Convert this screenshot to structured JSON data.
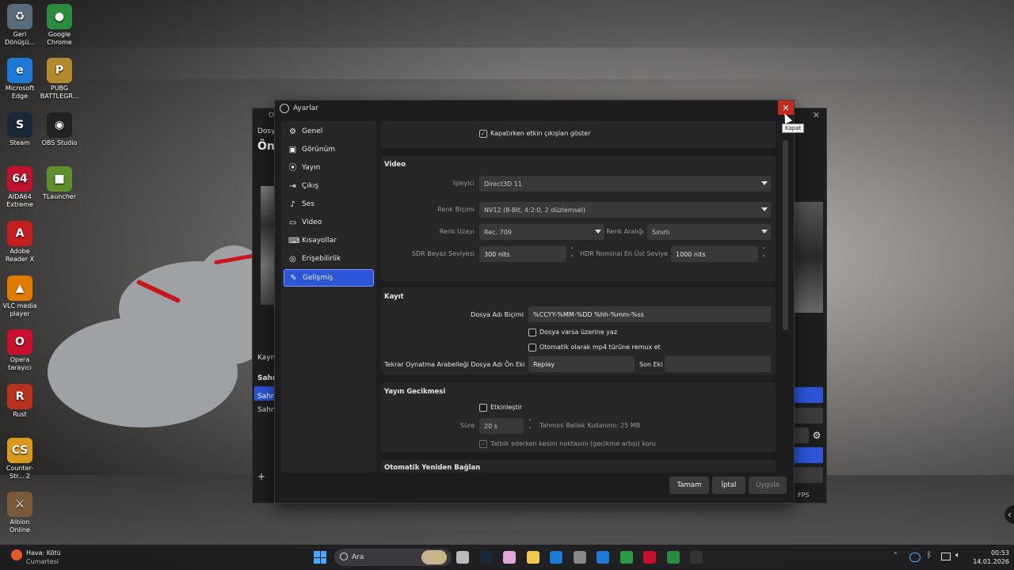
{
  "desktop": {
    "icons": [
      {
        "label": "Geri Dönüşü...",
        "glyph": "♻",
        "bg": "#5a6b7a"
      },
      {
        "label": "Google Chrome",
        "glyph": "●",
        "bg": "#2a8c3c"
      },
      {
        "label": "Microsoft Edge",
        "glyph": "e",
        "bg": "#1d7ad6"
      },
      {
        "label": "PUBG BATTLEGR...",
        "glyph": "P",
        "bg": "#b08a2c"
      },
      {
        "label": "Steam",
        "glyph": "S",
        "bg": "#1b2838"
      },
      {
        "label": "OBS Studio",
        "glyph": "◉",
        "bg": "#222"
      },
      {
        "label": "AIDA64 Extreme",
        "glyph": "64",
        "bg": "#c0122b"
      },
      {
        "label": "TLauncher",
        "glyph": "■",
        "bg": "#5f8f2c"
      },
      {
        "label": "Adobe Reader X",
        "glyph": "A",
        "bg": "#c41e1e"
      },
      {
        "label": "VLC media player",
        "glyph": "▲",
        "bg": "#e07b00"
      },
      {
        "label": "Opera tarayıcı",
        "glyph": "O",
        "bg": "#c8102e"
      },
      {
        "label": "Rust",
        "glyph": "R",
        "bg": "#b8321e"
      },
      {
        "label": "Counter-Str... 2",
        "glyph": "CS",
        "bg": "#d99a1c"
      },
      {
        "label": "Albion Online",
        "glyph": "⚔",
        "bg": "#7a5a3a"
      }
    ]
  },
  "obs_back": {
    "title_fragment": "Ol",
    "menu_fragment": "Dosya",
    "preview_fragment": "Öni",
    "sources_fragment": "Kayna",
    "scenes_header_fragment": "Sahne",
    "scene1_fragment": "Sahne",
    "scene2_fragment": "Sahne",
    "fps_text": "FPS"
  },
  "dialog": {
    "title": "Ayarlar",
    "close_glyph": "✕",
    "tooltip": "Kapat",
    "sidebar": [
      {
        "label": "Genel",
        "glyph": "⚙"
      },
      {
        "label": "Görünüm",
        "glyph": "▣"
      },
      {
        "label": "Yayın",
        "glyph": "⦿"
      },
      {
        "label": "Çıkış",
        "glyph": "⇥"
      },
      {
        "label": "Ses",
        "glyph": "♪"
      },
      {
        "label": "Video",
        "glyph": "▭"
      },
      {
        "label": "Kısayollar",
        "glyph": "⌨"
      },
      {
        "label": "Erişebilirlik",
        "glyph": "◎"
      },
      {
        "label": "Gelişmiş",
        "glyph": "✎"
      }
    ],
    "active_item": "Gelişmiş",
    "general": {
      "show_active_outputs_label": "Kapatırken etkin çıkışları göster"
    },
    "video": {
      "title": "Video",
      "renderer_label": "İşleyici",
      "renderer_value": "Direct3D 11",
      "color_format_label": "Renk Biçimi",
      "color_format_value": "NV12 (8-Bit, 4:2:0, 2 düzlemsel)",
      "color_space_label": "Renk Uzayı",
      "color_space_value": "Rec. 709",
      "color_range_label": "Renk Aralığı",
      "color_range_value": "Sınırlı",
      "sdr_label": "SDR Beyaz Seviyesi",
      "sdr_value": "300 nits",
      "hdr_label": "HDR Nominal En Üst Seviye",
      "hdr_value": "1000 nits"
    },
    "recording": {
      "title": "Kayıt",
      "filename_format_label": "Dosya Adı Biçimi",
      "filename_format_value": "%CCYY-%MM-%DD %hh-%mm-%ss",
      "overwrite_label": "Dosya varsa üzerine yaz",
      "remux_label": "Otomatik olarak mp4 türüne remux et",
      "replay_prefix_label": "Tekrar Oynatma Arabelleği Dosya Adı Ön Eki",
      "replay_prefix_value": "Replay",
      "suffix_label": "Son Eki",
      "suffix_value": ""
    },
    "stream_delay": {
      "title": "Yayın Gecikmesi",
      "enable_label": "Etkinleştir",
      "duration_label": "Süre",
      "duration_value": "20 s",
      "memory_label": "Tahmini Bellek Kullanımı: 25 MB",
      "preserve_label": "Tatbik ederken kesim noktasını (gecikme artışı) koru"
    },
    "reconnect": {
      "title": "Otomatik Yeniden Bağlan"
    },
    "buttons": {
      "ok": "Tamam",
      "cancel": "İptal",
      "apply": "Uygula"
    }
  },
  "taskbar": {
    "weather_line1": "Hava: Kötü",
    "weather_line2": "Cumartesi",
    "search_placeholder": "Ara",
    "time": "00:53",
    "date": "14.01.2026"
  }
}
